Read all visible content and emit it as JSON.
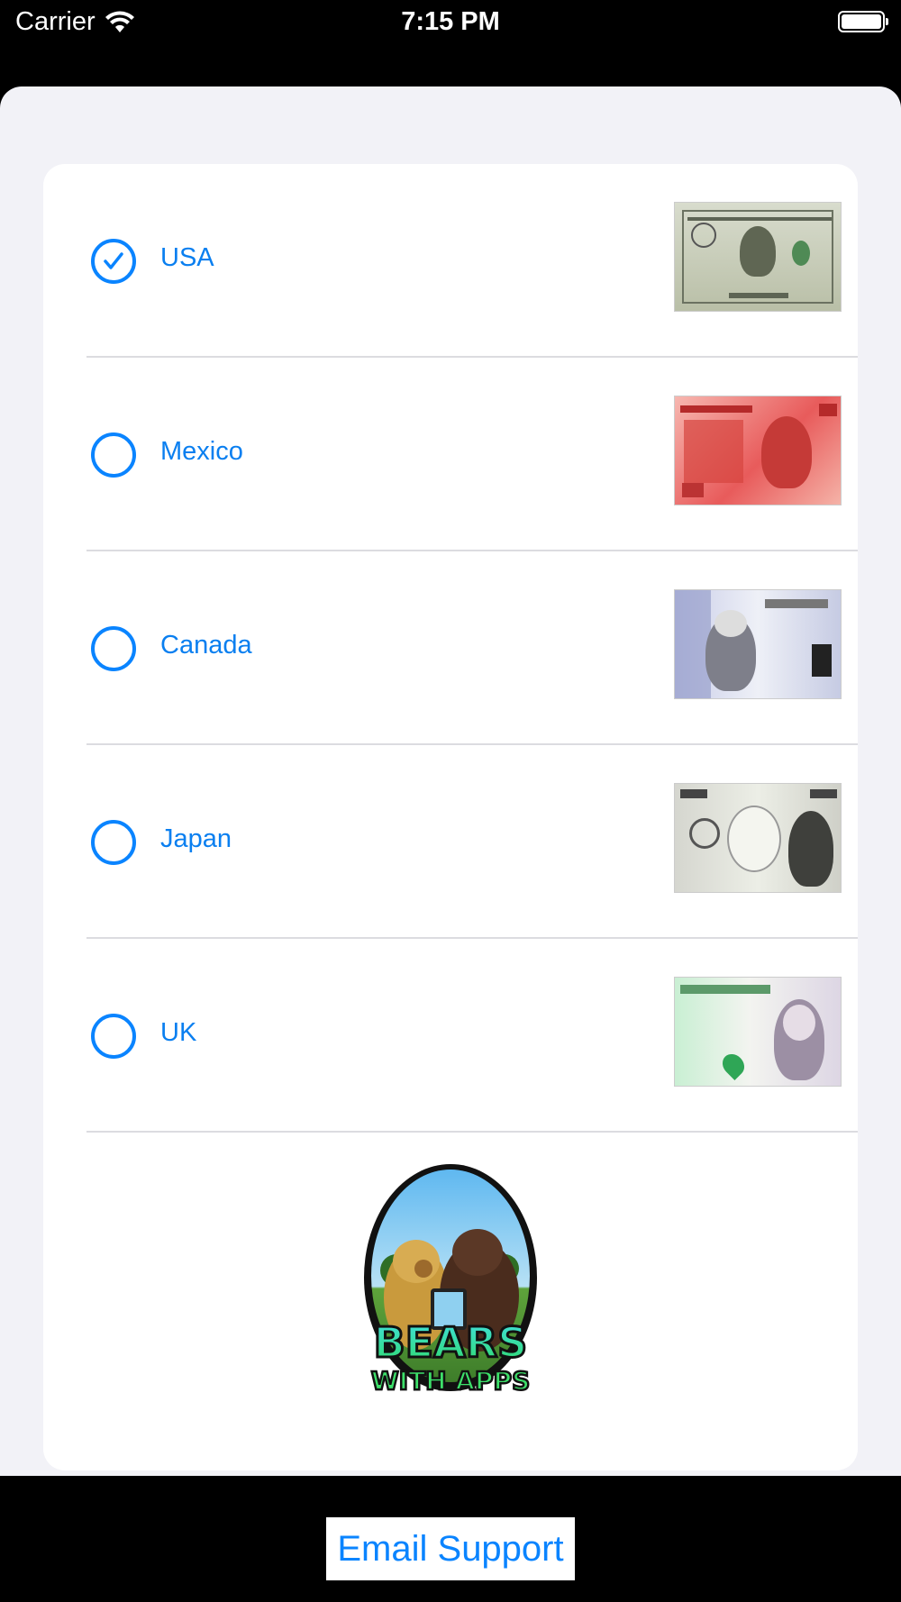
{
  "status_bar": {
    "carrier": "Carrier",
    "time": "7:15 PM"
  },
  "countries": [
    {
      "label": "USA",
      "selected": true,
      "bill_icon": "us-dollar-bill-image"
    },
    {
      "label": "Mexico",
      "selected": false,
      "bill_icon": "mexican-peso-bill-image"
    },
    {
      "label": "Canada",
      "selected": false,
      "bill_icon": "canadian-dollar-bill-image"
    },
    {
      "label": "Japan",
      "selected": false,
      "bill_icon": "japanese-yen-bill-image"
    },
    {
      "label": "UK",
      "selected": false,
      "bill_icon": "british-pound-bill-image"
    }
  ],
  "logo": {
    "line1": "BEARS",
    "line2": "WITH APPS"
  },
  "footer": {
    "email_label": "Email Support"
  },
  "colors": {
    "accent": "#0a84ff",
    "sheet_background": "#f2f2f7",
    "card_background": "#ffffff"
  }
}
